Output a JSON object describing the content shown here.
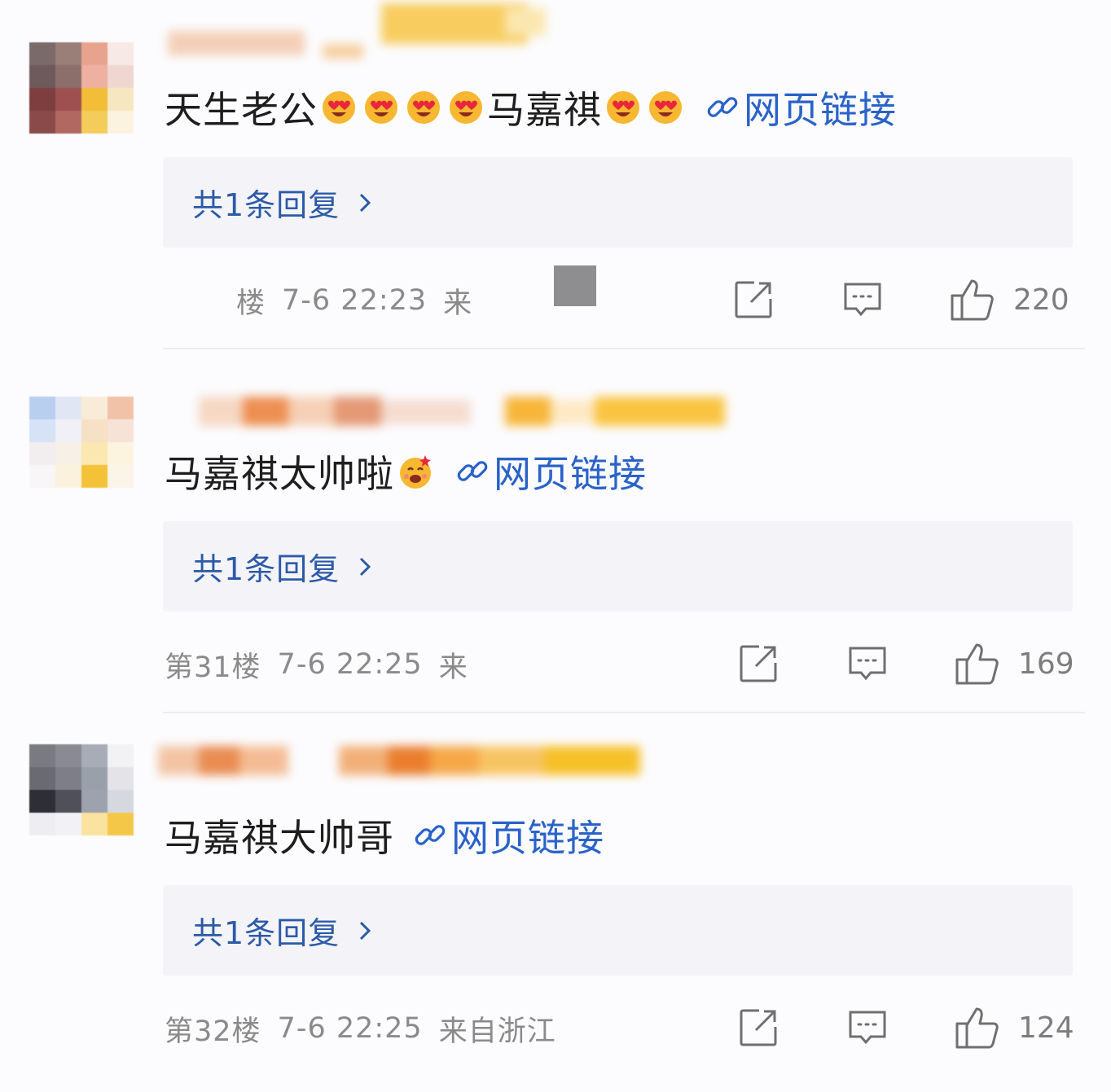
{
  "colors": {
    "background": "#fcfcfe",
    "link": "#2a62c9",
    "reply_text": "#2c5aa8",
    "meta_text": "#8a8a8a",
    "reply_bg": "#f4f4f8"
  },
  "link_label": "网页链接",
  "reply_label": "共1条回复",
  "comments": [
    {
      "text_before": "天生老公",
      "emoji_before": [
        "heart-eyes-emoji",
        "heart-eyes-emoji",
        "heart-eyes-emoji",
        "heart-eyes-emoji"
      ],
      "text_mid": "马嘉祺",
      "emoji_after": [
        "heart-eyes-emoji",
        "heart-eyes-emoji"
      ],
      "floor": "楼",
      "time": "7-6 22:23",
      "source": "来",
      "likes": "220"
    },
    {
      "text_before": "马嘉祺太帅啦",
      "emoji_after": [
        "excited-emoji"
      ],
      "floor": "第31楼",
      "time": "7-6 22:25",
      "source": "来",
      "likes": "169"
    },
    {
      "text_before": "马嘉祺大帅哥",
      "floor": "第32楼",
      "time": "7-6 22:25",
      "source": "来自浙江",
      "likes": "124"
    }
  ]
}
